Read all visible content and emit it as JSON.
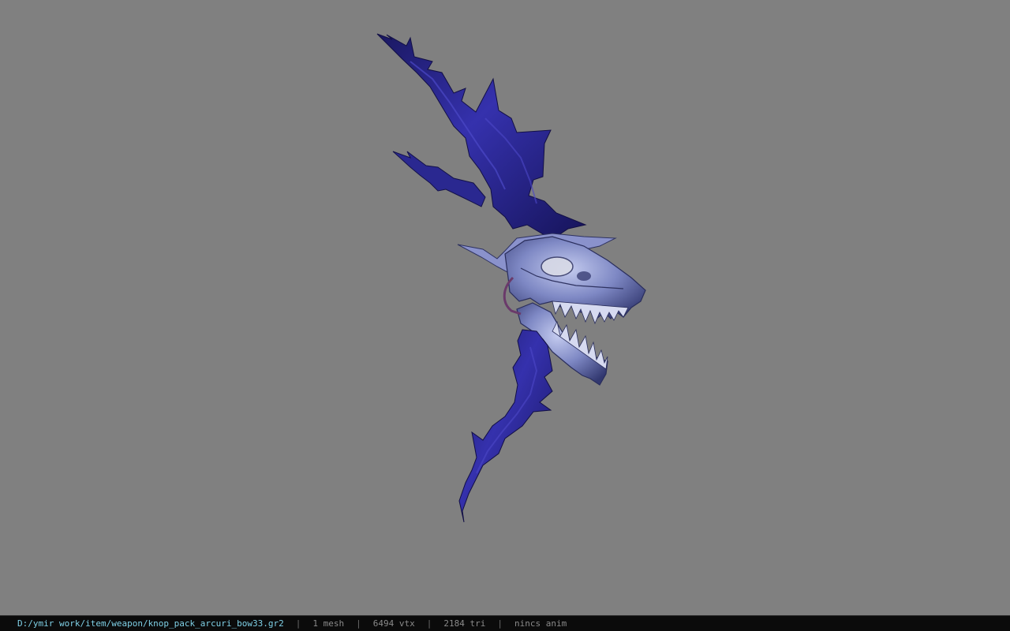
{
  "viewer": {
    "background_color": "#808080",
    "model_name": "knop_pack_arcuri_bow33",
    "model_colors": {
      "limb_dark": "#1e1c6e",
      "limb_mid": "#3a36b4",
      "skull_light": "#a8b0e0",
      "skull_mid": "#6e78b4",
      "skull_shadow": "#2e3260"
    }
  },
  "status_bar": {
    "file_path": "D:/ymir work/item/weapon/knop_pack_arcuri_bow33.gr2",
    "separator": "|",
    "mesh_count": "1 mesh",
    "vertex_count": "6494 vtx",
    "triangle_count": "2184 tri",
    "anim_info": "nincs anim",
    "path_color": "#7fd0e6",
    "background_color": "#0b0b0b"
  }
}
